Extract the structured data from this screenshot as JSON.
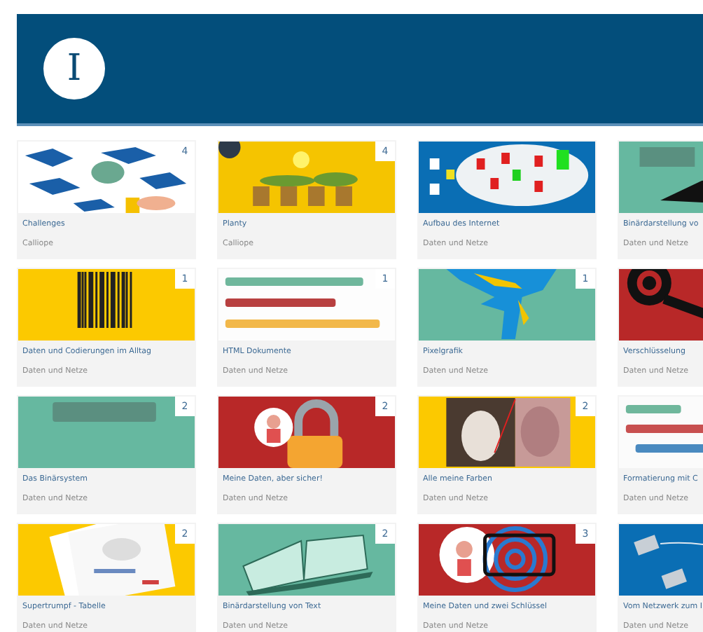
{
  "header": {
    "logo_letter": "I"
  },
  "cards": [
    {
      "title": "Challenges",
      "category": "Calliope",
      "badge": "4"
    },
    {
      "title": "Planty",
      "category": "Calliope",
      "badge": "4"
    },
    {
      "title": "Aufbau des Internet",
      "category": "Daten und Netze"
    },
    {
      "title": "Binärdarstellung vo",
      "category": "Daten und Netze"
    },
    {
      "title": "Daten und Codierungen im Alltag",
      "category": "Daten und Netze",
      "badge": "1"
    },
    {
      "title": "HTML Dokumente",
      "category": "Daten und Netze",
      "badge": "1"
    },
    {
      "title": "Pixelgrafik",
      "category": "Daten und Netze",
      "badge": "1"
    },
    {
      "title": "Verschlüsselung",
      "category": "Daten und Netze"
    },
    {
      "title": "Das Binärsystem",
      "category": "Daten und Netze",
      "badge": "2"
    },
    {
      "title": "Meine Daten, aber sicher!",
      "category": "Daten und Netze",
      "badge": "2"
    },
    {
      "title": "Alle meine Farben",
      "category": "Daten und Netze",
      "badge": "2"
    },
    {
      "title": "Formatierung mit C",
      "category": "Daten und Netze"
    },
    {
      "title": "Supertrumpf - Tabelle",
      "category": "Daten und Netze",
      "badge": "2"
    },
    {
      "title": "Binärdarstellung von Text",
      "category": "Daten und Netze",
      "badge": "2"
    },
    {
      "title": "Meine Daten und zwei Schlüssel",
      "category": "Daten und Netze",
      "badge": "3"
    },
    {
      "title": "Vom Netzwerk zum I",
      "category": "Daten und Netze"
    }
  ]
}
